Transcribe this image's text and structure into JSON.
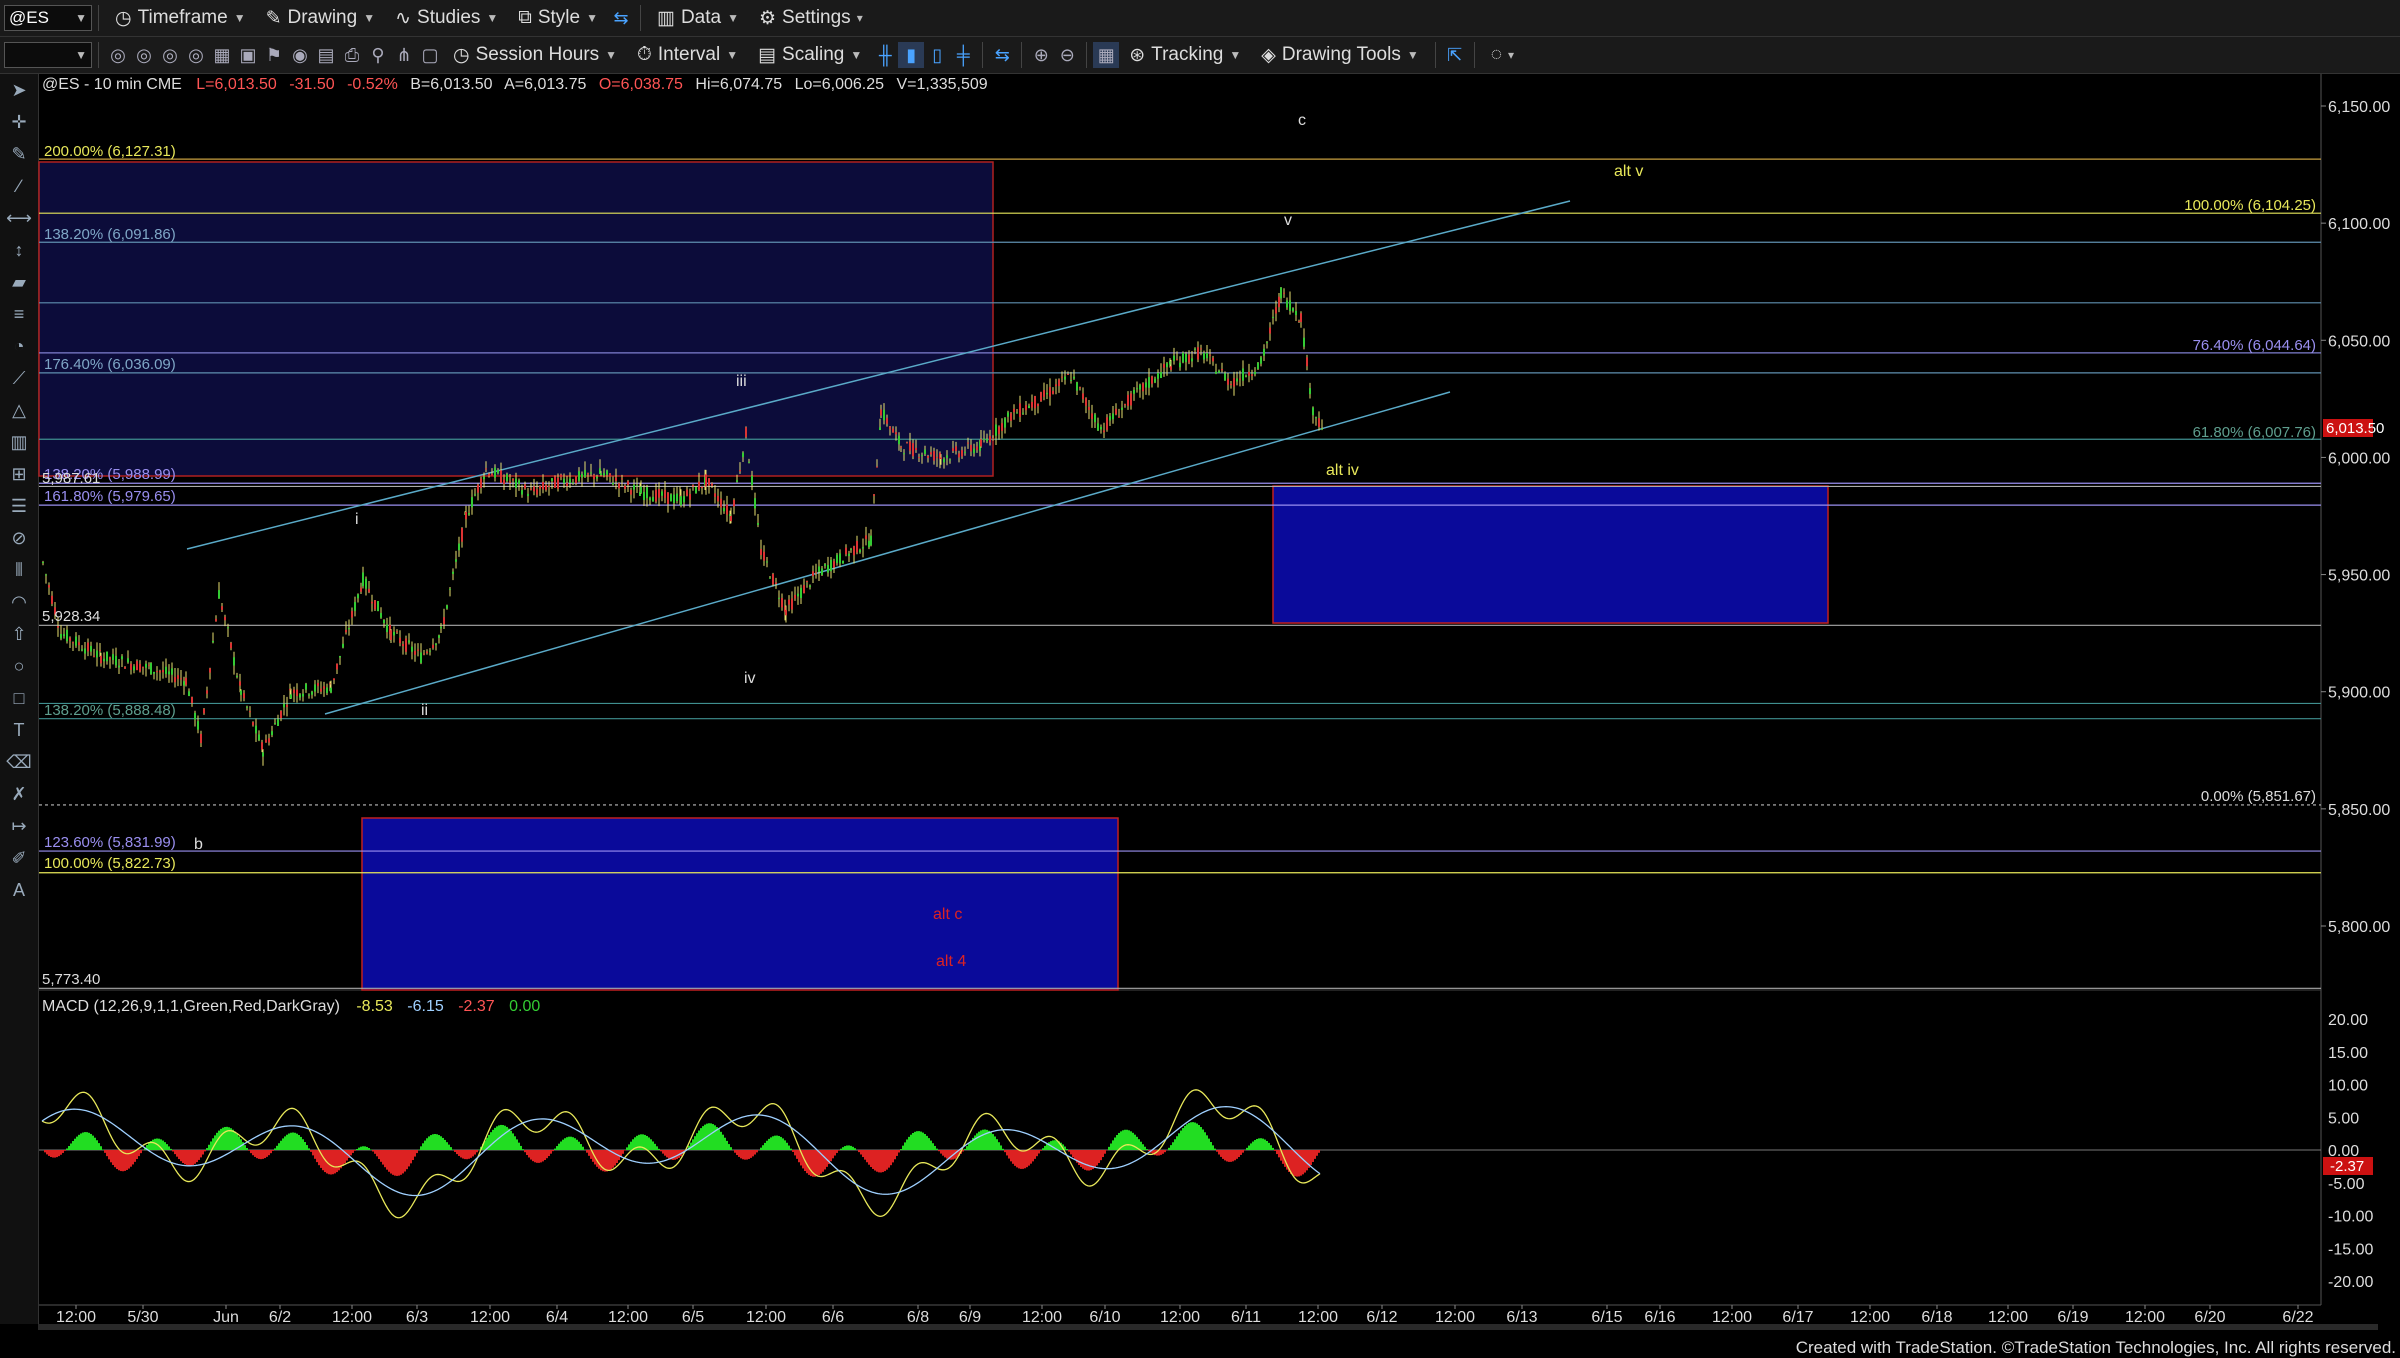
{
  "toolbar": {
    "symbol": "@ES",
    "timeframe": "Timeframe",
    "drawing": "Drawing",
    "studies": "Studies",
    "style": "Style",
    "data": "Data",
    "settings": "Settings",
    "session_hours": "Session Hours",
    "interval": "Interval",
    "scaling": "Scaling",
    "tracking": "Tracking",
    "drawing_tools": "Drawing Tools"
  },
  "chart": {
    "header": "@ES - 10 min  CME",
    "ohlc": [
      {
        "text": "L=6,013.50",
        "color": "#ff5555"
      },
      {
        "text": "-31.50",
        "color": "#ff5555"
      },
      {
        "text": "-0.52%",
        "color": "#ff5555"
      },
      {
        "text": "B=6,013.50",
        "color": "#dddddd"
      },
      {
        "text": "A=6,013.75",
        "color": "#dddddd"
      },
      {
        "text": "O=6,038.75",
        "color": "#ff5555"
      },
      {
        "text": "Hi=6,074.75",
        "color": "#dddddd"
      },
      {
        "text": "Lo=6,006.25",
        "color": "#dddddd"
      },
      {
        "text": "V=1,335,509",
        "color": "#dddddd"
      }
    ],
    "price_axis": [
      "6,150.00",
      "6,100.00",
      "6,050.00",
      "6,000.00",
      "5,950.00",
      "5,900.00",
      "5,850.00",
      "5,800.00"
    ],
    "last_price": "6,013.50",
    "macd_header": "MACD (12,26,9,1,1,Green,Red,DarkGray)",
    "macd_values": [
      {
        "text": "-8.53",
        "color": "#e8e85a"
      },
      {
        "text": "-6.15",
        "color": "#9fd0ff"
      },
      {
        "text": "-2.37",
        "color": "#ff5555"
      },
      {
        "text": "0.00",
        "color": "#33cc33"
      }
    ],
    "macd_axis": [
      "20.00",
      "15.00",
      "10.00",
      "5.00",
      "0.00",
      "-5.00",
      "-10.00",
      "-15.00",
      "-20.00"
    ],
    "macd_last": "-2.37",
    "time_axis": [
      "12:00",
      "5/30",
      "Jun",
      "6/2",
      "12:00",
      "6/3",
      "12:00",
      "6/4",
      "12:00",
      "6/5",
      "12:00",
      "6/6",
      "6/8",
      "6/9",
      "12:00",
      "6/10",
      "12:00",
      "6/11",
      "12:00",
      "6/12",
      "12:00",
      "6/13",
      "6/15",
      "6/16",
      "12:00",
      "6/17",
      "12:00",
      "6/18",
      "12:00",
      "6/19",
      "12:00",
      "6/20",
      "6/22"
    ],
    "fib_labels": [
      {
        "text": "200.00% (6,127.31)",
        "color": "#e8e85a"
      },
      {
        "text": "138.20% (6,091.86)",
        "color": "#7fa7c7"
      },
      {
        "text": "176.40% (6,036.09)",
        "color": "#7fa7c7"
      },
      {
        "text": "138.20% (5,988.99)",
        "color": "#9a8ff0"
      },
      {
        "text": "5,987.61",
        "color": "#dddddd"
      },
      {
        "text": "161.80% (5,979.65)",
        "color": "#9a8ff0"
      },
      {
        "text": "5,928.34",
        "color": "#dddddd"
      },
      {
        "text": "138.20% (5,888.48)",
        "color": "#5f9f8f"
      },
      {
        "text": "123.60% (5,831.99)",
        "color": "#9a8ff0"
      },
      {
        "text": "100.00% (5,822.73)",
        "color": "#e8e85a"
      },
      {
        "text": "5,773.40",
        "color": "#dddddd"
      },
      {
        "text": "100.00% (6,104.25)",
        "color": "#e8e85a"
      },
      {
        "text": "76.40% (6,044.64)",
        "color": "#9a8ff0"
      },
      {
        "text": "61.80% (6,007.76)",
        "color": "#5f9f8f"
      },
      {
        "text": "0.00% (5,851.67)",
        "color": "#dddddd"
      }
    ],
    "wave_labels": [
      {
        "text": "c",
        "color": "#dddddd"
      },
      {
        "text": "v",
        "color": "#dddddd"
      },
      {
        "text": "alt v",
        "color": "#e8e85a"
      },
      {
        "text": "iii",
        "color": "#dddddd"
      },
      {
        "text": "i",
        "color": "#dddddd"
      },
      {
        "text": "iv",
        "color": "#dddddd"
      },
      {
        "text": "ii",
        "color": "#dddddd"
      },
      {
        "text": "alt iv",
        "color": "#e8e85a"
      },
      {
        "text": "b",
        "color": "#dddddd"
      },
      {
        "text": "alt c",
        "color": "#dd2222"
      },
      {
        "text": "alt 4",
        "color": "#dd2222"
      }
    ]
  },
  "footer": "Created with TradeStation. ©TradeStation Technologies, Inc. All rights reserved."
}
